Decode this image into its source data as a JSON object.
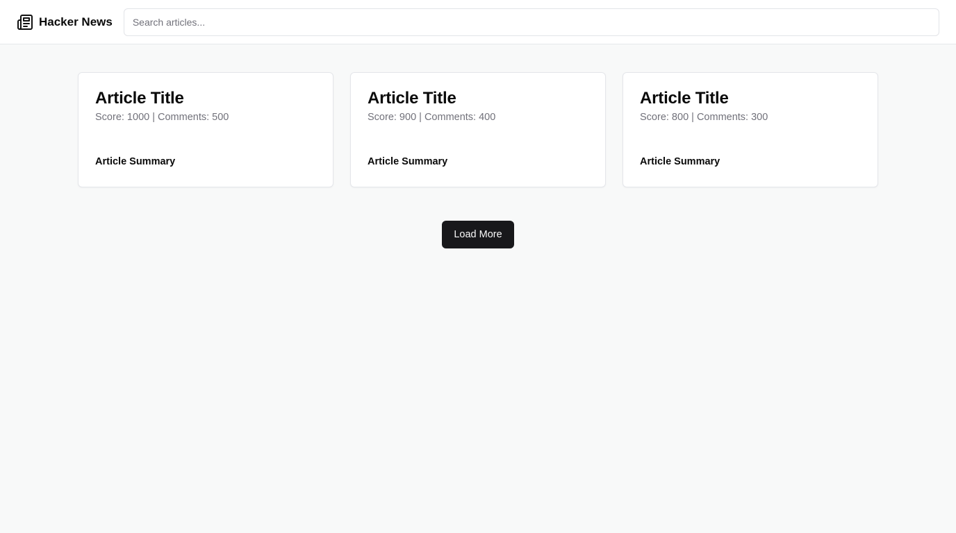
{
  "header": {
    "brand_icon": "newspaper-icon",
    "title": "Hacker News",
    "search_placeholder": "Search articles...",
    "search_value": ""
  },
  "articles": [
    {
      "title": "Article Title",
      "meta": "Score: 1000 | Comments: 500",
      "summary": "Article Summary"
    },
    {
      "title": "Article Title",
      "meta": "Score: 900 | Comments: 400",
      "summary": "Article Summary"
    },
    {
      "title": "Article Title",
      "meta": "Score: 800 | Comments: 300",
      "summary": "Article Summary"
    }
  ],
  "load_more_label": "Load More",
  "colors": {
    "background": "#f8f9f9",
    "button": "#18181b",
    "muted_text": "#71717a"
  }
}
